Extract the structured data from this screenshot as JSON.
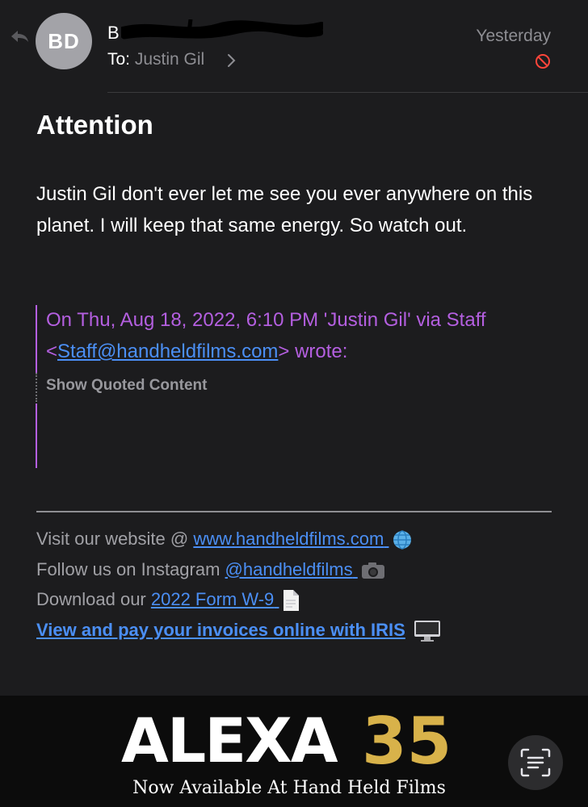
{
  "header": {
    "avatar_initials": "BD",
    "sender_visible": "B",
    "to_label": "To:",
    "recipient": "Justin Gil",
    "date": "Yesterday"
  },
  "email": {
    "subject": "Attention",
    "body": "Justin Gil don't ever let me see you ever anywhere on this planet. I will keep that same energy. So watch out.",
    "quote_prefix": "On Thu, Aug 18, 2022, 6:10 PM 'Justin Gil' via Staff <",
    "quote_email": "Staff@handheldfilms.com",
    "quote_suffix": "> wrote:",
    "show_quoted": "Show Quoted Content"
  },
  "signature": {
    "website_prefix": "Visit our website @ ",
    "website_link": "www.handheldfilms.com",
    "instagram_prefix": "Follow us on Instagram ",
    "instagram_link": "@handheldfilms",
    "w9_prefix": "Download our ",
    "w9_link": "2022 Form W-9",
    "invoices_link": "View and pay your invoices online with IRIS"
  },
  "banner": {
    "brand": "ALEXA",
    "model": "35",
    "tagline": "Now Available At Hand Held Films"
  },
  "icons": {
    "reply": "reply-arrow-icon",
    "blocked": "blocked-sender-icon",
    "globe": "globe-icon",
    "camera": "camera-icon",
    "document": "document-icon",
    "computer": "computer-icon",
    "live_text": "live-text-scan-icon"
  },
  "colors": {
    "background": "#1c1c1e",
    "quote": "#b45fe0",
    "link": "#4b8ff5",
    "blocked": "#ff453a",
    "brand_gold": "#d8b24a"
  }
}
